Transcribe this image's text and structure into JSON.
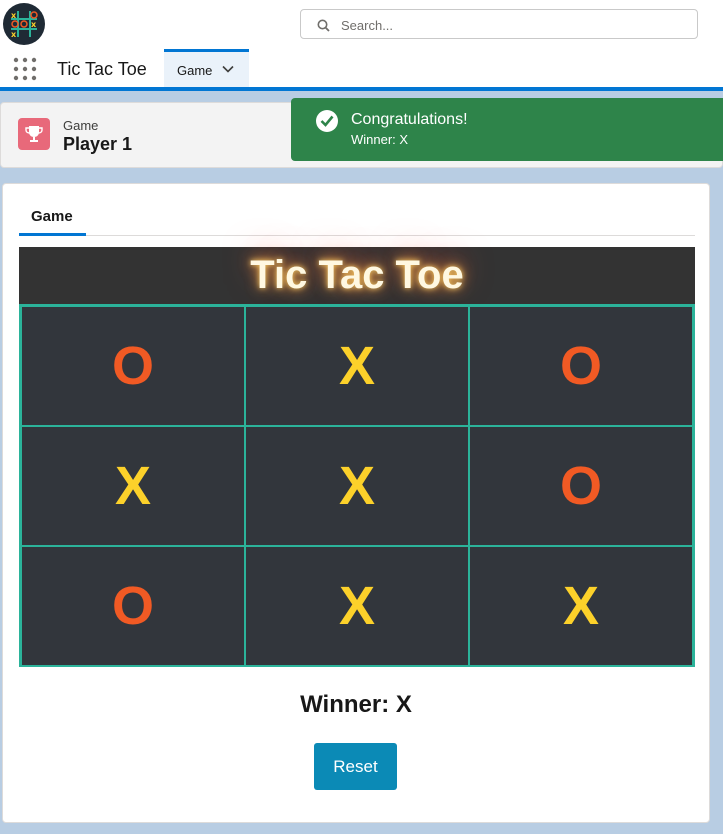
{
  "header": {
    "search_placeholder": "Search...",
    "app_name": "Tic Tac Toe",
    "nav_tab_label": "Game"
  },
  "page_header": {
    "object_label": "Game",
    "record_title": "Player 1"
  },
  "toast": {
    "title": "Congratulations!",
    "message": "Winner: X"
  },
  "tabs": [
    "Game"
  ],
  "game": {
    "title": "Tic Tac Toe",
    "board": [
      "O",
      "X",
      "O",
      "X",
      "X",
      "O",
      "O",
      "X",
      "X"
    ],
    "winner_text": "Winner: X",
    "reset_label": "Reset"
  },
  "colors": {
    "x": "#fcd12a",
    "o": "#f15a24",
    "grid": "#2bb39a",
    "toast_success": "#2e844a",
    "reset_button": "#0b8ab6"
  }
}
